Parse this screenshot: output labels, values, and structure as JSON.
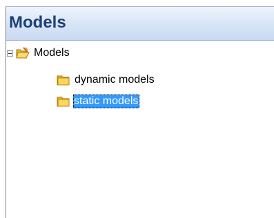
{
  "panel": {
    "title": "Models"
  },
  "tree": {
    "root": {
      "label": "Models",
      "expanded": true,
      "icon": "open-folder-icon"
    },
    "children": [
      {
        "label": "dynamic models",
        "icon": "folder-icon",
        "selected": false
      },
      {
        "label": "static models",
        "icon": "folder-icon",
        "selected": true
      }
    ]
  },
  "colors": {
    "title_text": "#1c3f77",
    "header_gradient_top": "#eef4fc",
    "header_gradient_bottom": "#c8d9f1",
    "selection_background": "#3399ff",
    "selection_text": "#ffffff"
  }
}
